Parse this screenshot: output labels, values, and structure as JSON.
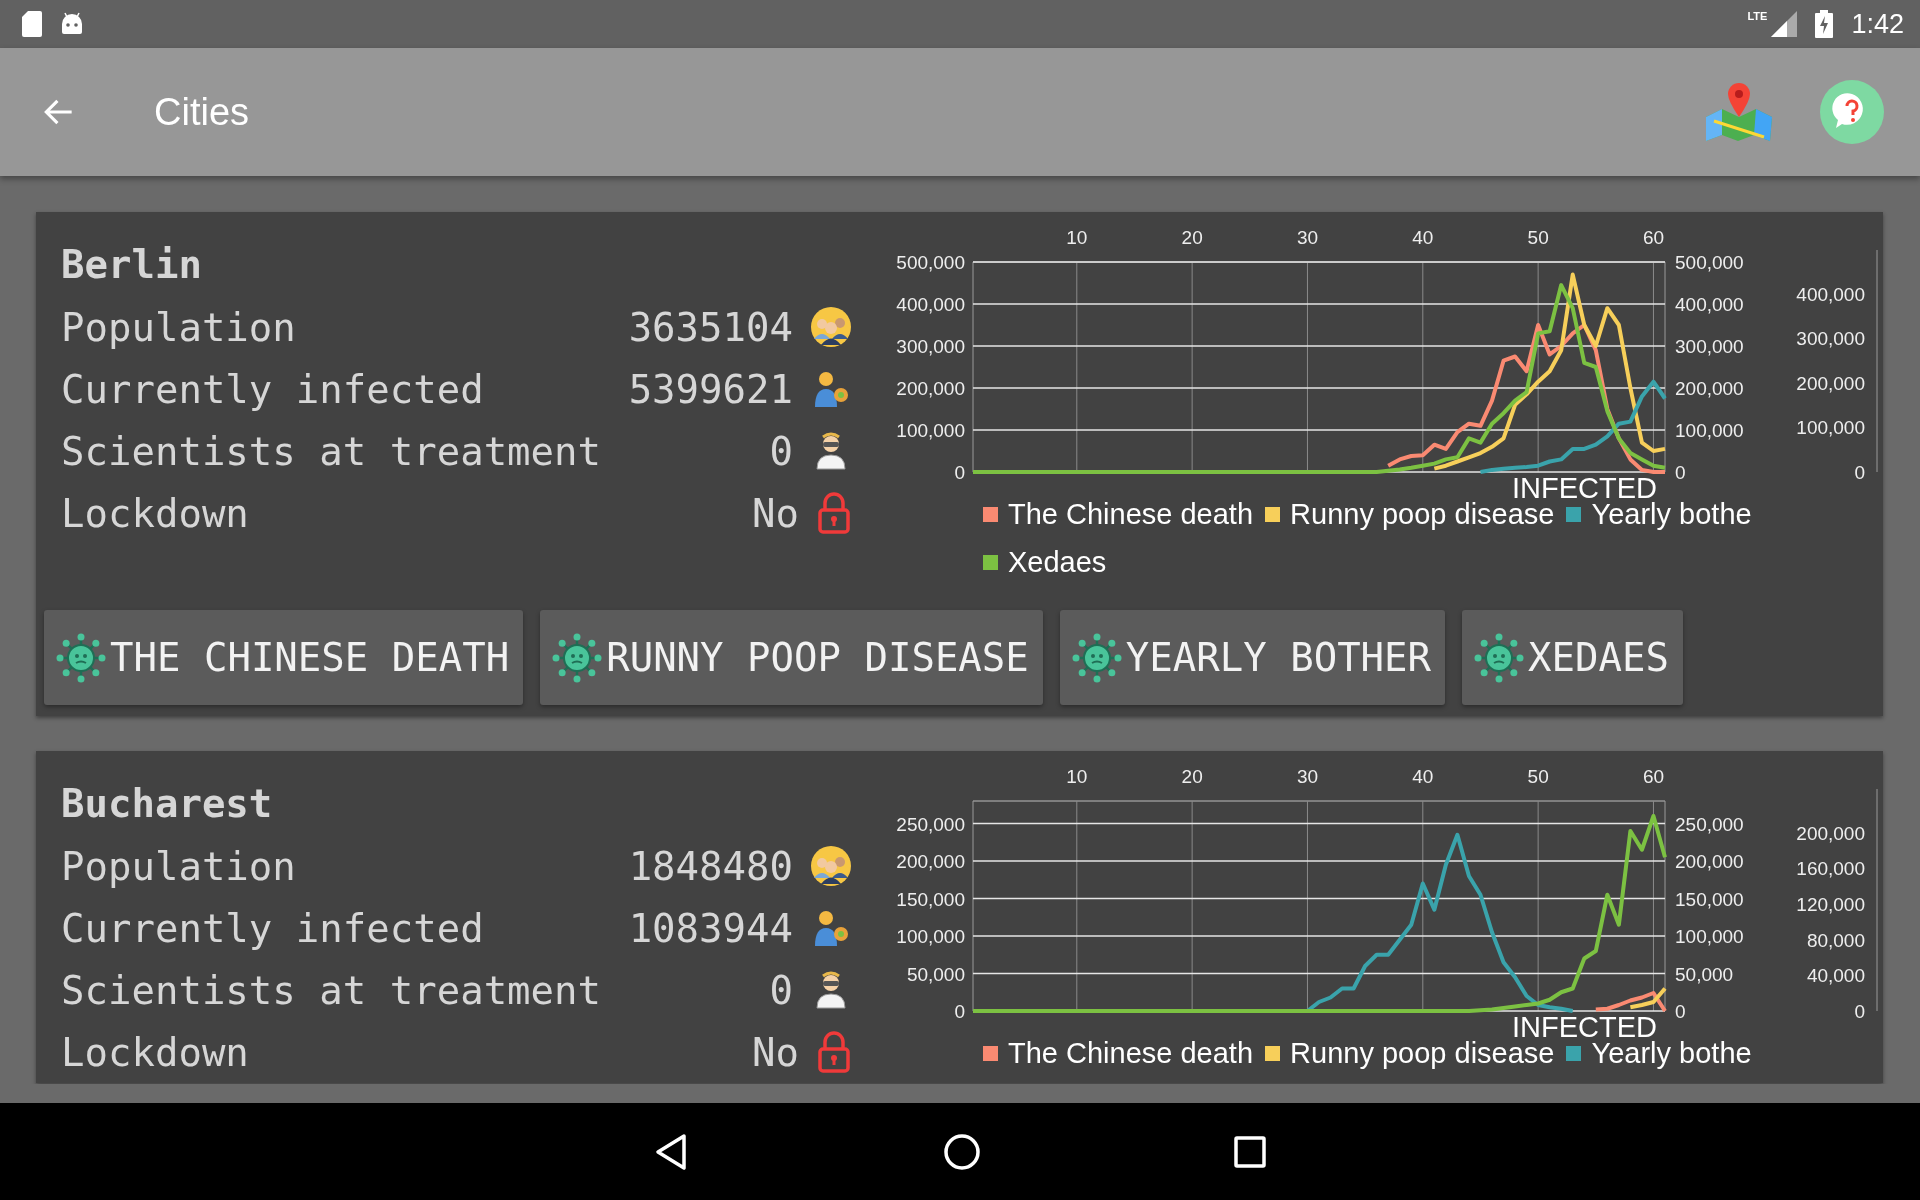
{
  "status_bar": {
    "network": "LTE",
    "time": "1:42"
  },
  "app_bar": {
    "title": "Cities"
  },
  "cities": [
    {
      "name": "Berlin",
      "stats": [
        {
          "kind": "population",
          "label": "Population",
          "value": "3635104"
        },
        {
          "kind": "infected",
          "label": "Currently infected",
          "value": "5399621"
        },
        {
          "kind": "scientists",
          "label": "Scientists at treatment",
          "value": "0"
        },
        {
          "kind": "lockdown",
          "label": "Lockdown",
          "value": "No"
        }
      ],
      "chart": {
        "chart_data": {
          "type": "line",
          "grid": true,
          "x": [
            1,
            10,
            20,
            30,
            31,
            32,
            33,
            34,
            35,
            36,
            37,
            38,
            39,
            40,
            41,
            42,
            43,
            44,
            45,
            46,
            47,
            48,
            49,
            50,
            51,
            52,
            53,
            54,
            55,
            56,
            57,
            58,
            59,
            60,
            61
          ],
          "xlim": [
            1,
            61
          ],
          "ylim": [
            0,
            500000
          ],
          "xticks": [
            10,
            20,
            30,
            40,
            50,
            60
          ],
          "yticks": [
            {
              "value": 0,
              "label": "0"
            },
            {
              "value": 100000,
              "label": "100,000"
            },
            {
              "value": 200000,
              "label": "200,000"
            },
            {
              "value": 300000,
              "label": "300,000"
            },
            {
              "value": 400000,
              "label": "400,000"
            },
            {
              "value": 500000,
              "label": "500,000"
            }
          ],
          "series": [
            {
              "color": "#fa8a72",
              "values": [
                null,
                null,
                null,
                null,
                null,
                null,
                null,
                null,
                null,
                null,
                15000,
                30000,
                38000,
                40000,
                65000,
                55000,
                95000,
                115000,
                110000,
                170000,
                265000,
                275000,
                240000,
                350000,
                280000,
                300000,
                330000,
                350000,
                290000,
                150000,
                80000,
                30000,
                5000,
                0,
                0
              ]
            },
            {
              "color": "#f7cf5a",
              "values": [
                null,
                null,
                null,
                null,
                null,
                null,
                null,
                null,
                null,
                null,
                null,
                null,
                null,
                null,
                8000,
                15000,
                25000,
                35000,
                45000,
                60000,
                80000,
                160000,
                185000,
                215000,
                240000,
                290000,
                470000,
                350000,
                300000,
                390000,
                350000,
                200000,
                70000,
                50000,
                55000
              ]
            },
            {
              "color": "#3aa3ab",
              "values": [
                null,
                null,
                null,
                null,
                null,
                null,
                null,
                null,
                null,
                null,
                null,
                null,
                null,
                null,
                null,
                null,
                null,
                null,
                0,
                5000,
                8000,
                10000,
                12000,
                15000,
                25000,
                30000,
                55000,
                55000,
                65000,
                85000,
                115000,
                120000,
                180000,
                215000,
                175000
              ]
            },
            {
              "color": "#7cc142",
              "values": [
                0,
                0,
                0,
                0,
                0,
                0,
                0,
                0,
                0,
                0,
                3000,
                6000,
                10000,
                15000,
                20000,
                30000,
                35000,
                80000,
                70000,
                115000,
                140000,
                170000,
                190000,
                330000,
                335000,
                445000,
                390000,
                260000,
                250000,
                145000,
                80000,
                45000,
                30000,
                15000,
                10000
              ]
            }
          ],
          "annotations": [
            {
              "text": "INFECTED"
            }
          ]
        },
        "right_axis_labels": [
          "500,000",
          "400,000",
          "300,000",
          "200,000",
          "100,000",
          "0"
        ],
        "far_axis_labels": [
          "400,000",
          "300,000",
          "200,000",
          "100,000",
          "0"
        ],
        "legend": [
          {
            "label": "The Chinese death",
            "color": "#fa8a72"
          },
          {
            "label": "Runny poop disease",
            "color": "#f7cf5a"
          },
          {
            "label": "Yearly bothe",
            "color": "#3aa3ab"
          },
          {
            "label": "Xedaes",
            "color": "#7cc142"
          }
        ]
      },
      "diseases": [
        "THE CHINESE DEATH",
        "RUNNY POOP DISEASE",
        "YEARLY BOTHER",
        "XEDAES"
      ]
    },
    {
      "name": "Bucharest",
      "stats": [
        {
          "kind": "population",
          "label": "Population",
          "value": "1848480"
        },
        {
          "kind": "infected",
          "label": "Currently infected",
          "value": "1083944"
        },
        {
          "kind": "scientists",
          "label": "Scientists at treatment",
          "value": "0"
        },
        {
          "kind": "lockdown",
          "label": "Lockdown",
          "value": "No"
        }
      ],
      "chart": {
        "chart_data": {
          "type": "line",
          "grid": true,
          "x": [
            1,
            10,
            20,
            30,
            31,
            32,
            33,
            34,
            35,
            36,
            37,
            38,
            39,
            40,
            41,
            42,
            43,
            44,
            45,
            46,
            47,
            48,
            49,
            50,
            51,
            52,
            53,
            54,
            55,
            56,
            57,
            58,
            59,
            60,
            61
          ],
          "xlim": [
            1,
            61
          ],
          "ylim": [
            0,
            280000
          ],
          "xticks": [
            10,
            20,
            30,
            40,
            50,
            60
          ],
          "yticks": [
            {
              "value": 0,
              "label": "0"
            },
            {
              "value": 50000,
              "label": "50,000"
            },
            {
              "value": 100000,
              "label": "100,000"
            },
            {
              "value": 150000,
              "label": "150,000"
            },
            {
              "value": 200000,
              "label": "200,000"
            },
            {
              "value": 250000,
              "label": "250,000"
            }
          ],
          "series": [
            {
              "color": "#fa8a72",
              "values": [
                null,
                null,
                null,
                null,
                null,
                null,
                null,
                null,
                null,
                null,
                null,
                null,
                null,
                null,
                null,
                null,
                null,
                null,
                null,
                null,
                null,
                null,
                null,
                null,
                null,
                null,
                null,
                null,
                2000,
                3000,
                8000,
                14000,
                18000,
                24000,
                0
              ]
            },
            {
              "color": "#f7cf5a",
              "values": [
                null,
                null,
                null,
                null,
                null,
                null,
                null,
                null,
                null,
                null,
                null,
                null,
                null,
                null,
                null,
                null,
                null,
                null,
                null,
                null,
                null,
                null,
                null,
                null,
                null,
                null,
                null,
                null,
                null,
                null,
                null,
                5000,
                8000,
                12000,
                30000
              ]
            },
            {
              "color": "#3aa3ab",
              "values": [
                null,
                null,
                null,
                0,
                12000,
                18000,
                30000,
                30000,
                60000,
                75000,
                75000,
                95000,
                115000,
                170000,
                135000,
                195000,
                235000,
                180000,
                155000,
                105000,
                65000,
                45000,
                20000,
                8000,
                5000,
                3000,
                0,
                null,
                null,
                null,
                null,
                null,
                null,
                null,
                null
              ]
            },
            {
              "color": "#7cc142",
              "values": [
                0,
                0,
                0,
                0,
                0,
                0,
                0,
                0,
                0,
                0,
                0,
                0,
                0,
                0,
                0,
                0,
                0,
                0,
                1000,
                2000,
                4000,
                6000,
                8000,
                10000,
                15000,
                25000,
                30000,
                70000,
                80000,
                155000,
                115000,
                240000,
                215000,
                260000,
                205000
              ]
            }
          ],
          "annotations": [
            {
              "text": "INFECTED"
            }
          ]
        },
        "right_axis_labels": [
          "250,000",
          "200,000",
          "150,000",
          "100,000",
          "50,000",
          "0"
        ],
        "far_axis_labels": [
          "200,000",
          "160,000",
          "120,000",
          "80,000",
          "40,000",
          "0"
        ],
        "legend": [
          {
            "label": "The Chinese death",
            "color": "#fa8a72"
          },
          {
            "label": "Runny poop disease",
            "color": "#f7cf5a"
          },
          {
            "label": "Yearly bothe",
            "color": "#3aa3ab"
          }
        ]
      }
    }
  ]
}
